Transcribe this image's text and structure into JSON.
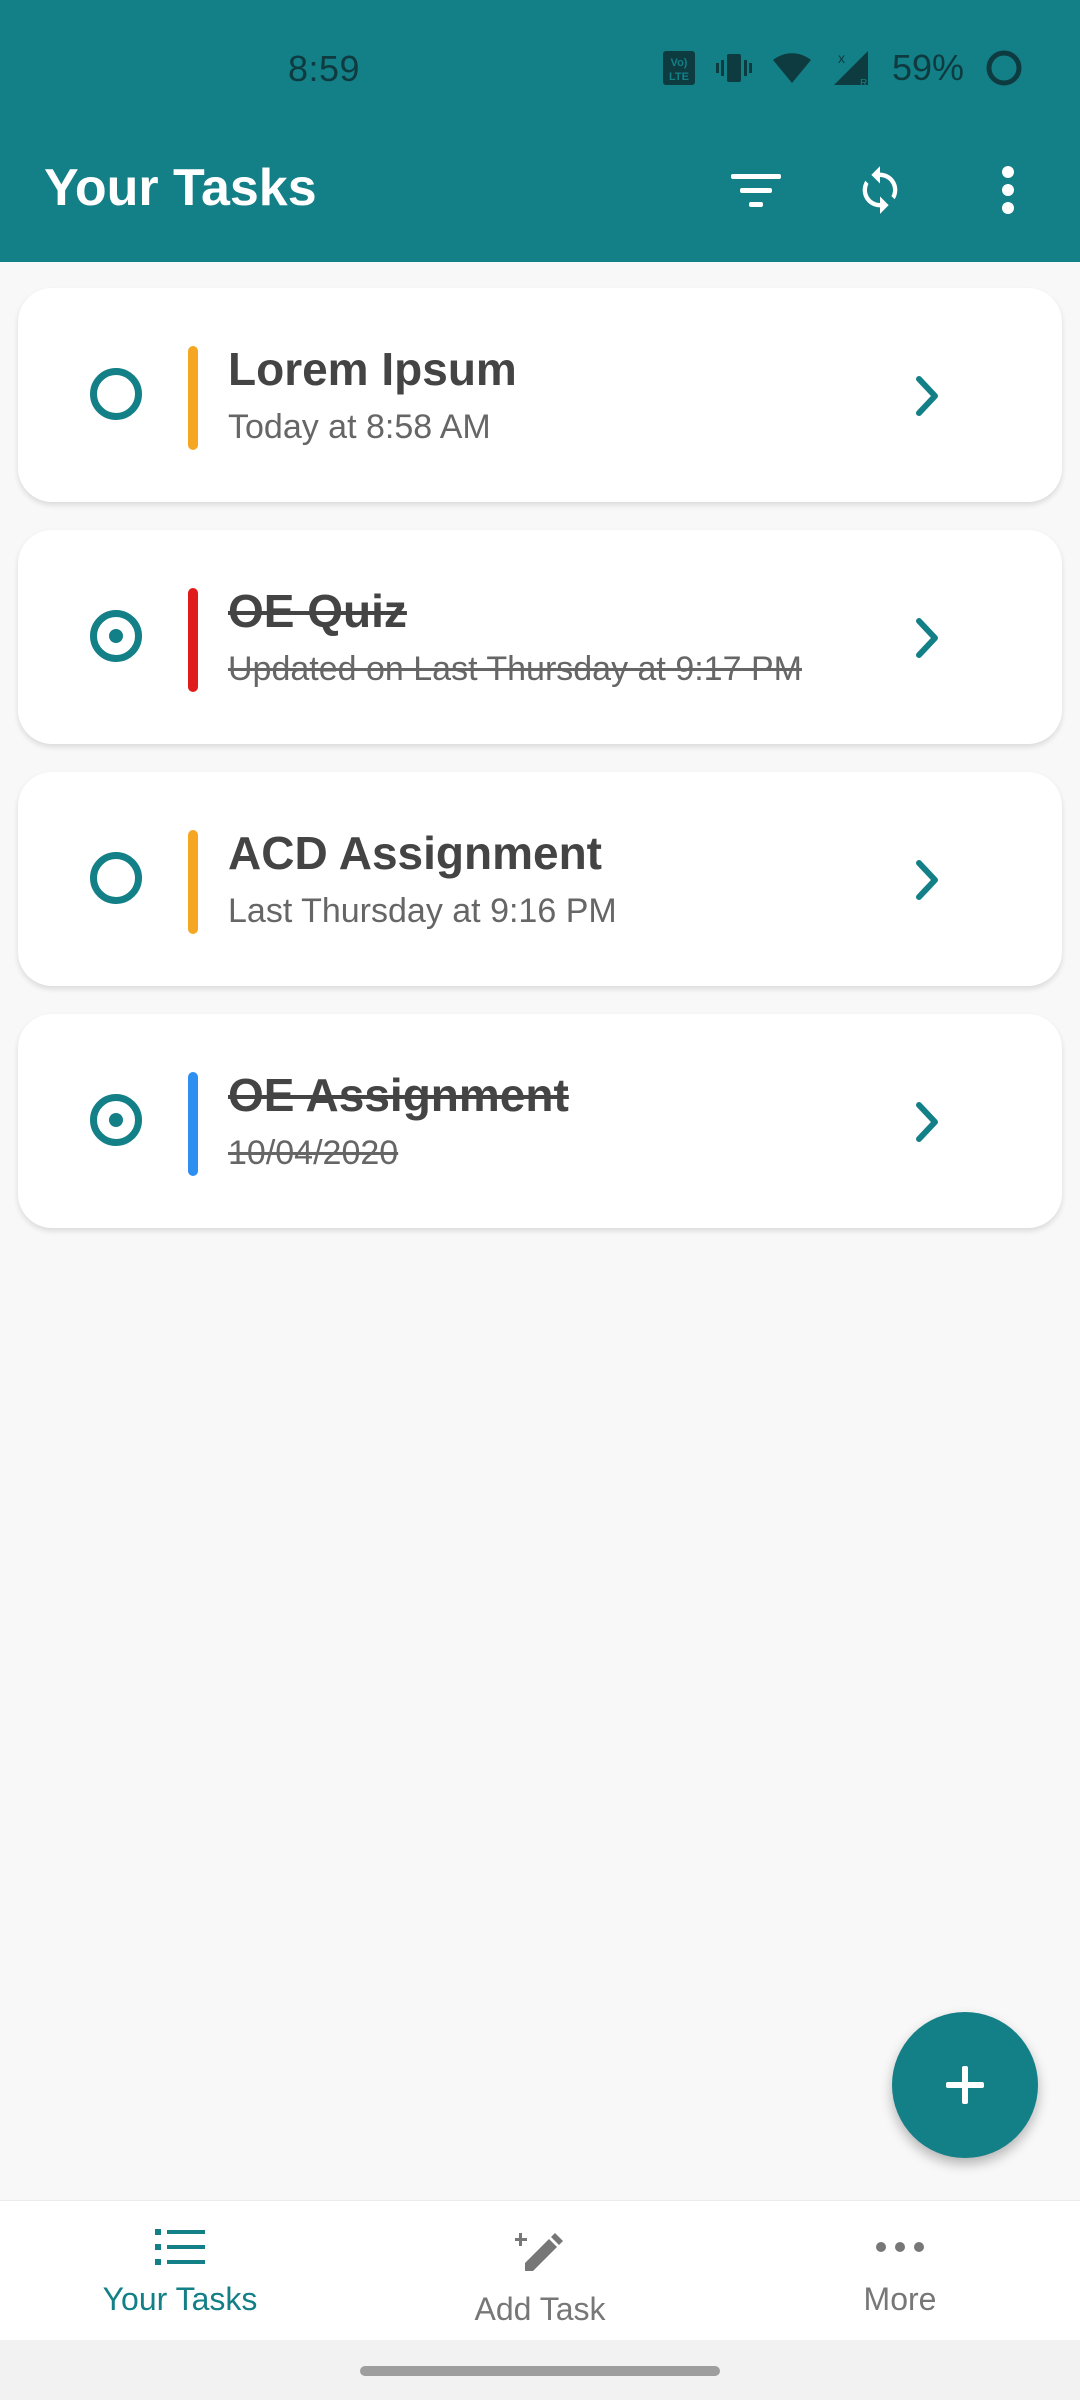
{
  "status_bar": {
    "time": "8:59",
    "battery_percent": "59%",
    "icons": [
      "volte-icon",
      "vibrate-icon",
      "wifi-icon",
      "signal-icon",
      "battery-ring-icon"
    ]
  },
  "app_bar": {
    "title": "Your Tasks",
    "actions": [
      "filter-icon",
      "sync-icon",
      "more-vert-icon"
    ],
    "color": "#137f87"
  },
  "tasks": [
    {
      "title": "Lorem Ipsum",
      "subtitle": "Today at 8:58 AM",
      "completed": false,
      "color": "#f5a623"
    },
    {
      "title": "OE Quiz",
      "subtitle": "Updated on Last Thursday at 9:17 PM",
      "completed": true,
      "color": "#e01b1b"
    },
    {
      "title": "ACD Assignment",
      "subtitle": "Last Thursday at 9:16 PM",
      "completed": false,
      "color": "#f5a623"
    },
    {
      "title": "OE Assignment",
      "subtitle": "10/04/2020",
      "completed": true,
      "color": "#2d8ff0"
    }
  ],
  "fab": {
    "icon": "plus-icon"
  },
  "bottom_nav": {
    "items": [
      {
        "label": "Your Tasks",
        "icon": "list-icon",
        "active": true
      },
      {
        "label": "Add Task",
        "icon": "edit-icon",
        "active": false
      },
      {
        "label": "More",
        "icon": "more-horiz-icon",
        "active": false
      }
    ]
  }
}
